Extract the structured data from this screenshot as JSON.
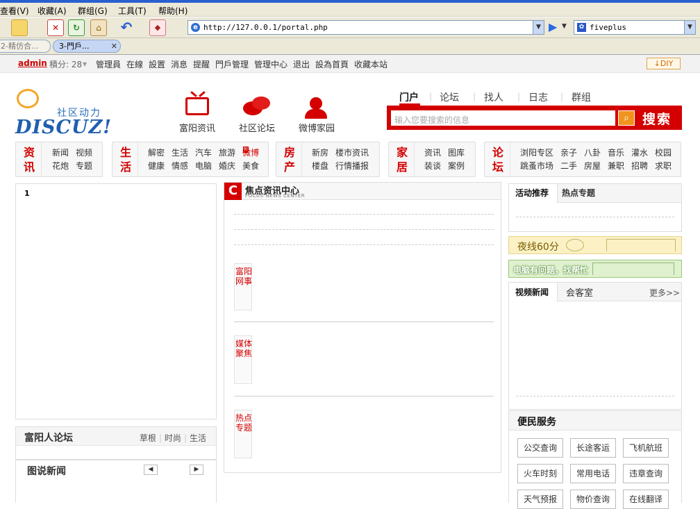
{
  "browser": {
    "menu": [
      "查看(V)",
      "收藏(A)",
      "群组(G)",
      "工具(T)",
      "帮助(H)"
    ],
    "address": "http://127.0.0.1/portal.php",
    "search_engine_value": "fiveplus",
    "tabs": [
      {
        "label": "2-精仿合..."
      },
      {
        "label": "3-門戶..."
      }
    ]
  },
  "topnav": {
    "user": "admin",
    "points_label": "積分: 28",
    "links": [
      "管理員",
      "在線",
      "設置",
      "消息",
      "提醒",
      "門戶管理",
      "管理中心",
      "退出",
      "設為首頁",
      "收藏本站"
    ],
    "diy": "DIY"
  },
  "header": {
    "logo_slogan": "社区动力",
    "logo_brand": "DISCUZ!",
    "nav_icons": [
      {
        "label": "富阳资讯",
        "icon": "tv-icon"
      },
      {
        "label": "社区论坛",
        "icon": "chat-bubbles-icon"
      },
      {
        "label": "微博家园",
        "icon": "person-icon"
      }
    ],
    "search_tabs": [
      "门户",
      "论坛",
      "找人",
      "日志",
      "群组"
    ],
    "search_placeholder": "输入您要搜索的信息",
    "search_button": "搜索"
  },
  "categories": [
    {
      "head": [
        "资",
        "讯"
      ],
      "links": [
        "新闻",
        "视频",
        "花炮",
        "专题"
      ]
    },
    {
      "head": [
        "生",
        "活"
      ],
      "links": [
        "解密",
        "生活",
        "汽车",
        "旅游",
        "微博",
        "健康",
        "情感",
        "电脑",
        "婚庆",
        "美食"
      ],
      "hot": "微博",
      "hot_badge": "N"
    },
    {
      "head": [
        "房",
        "产"
      ],
      "links": [
        "新房",
        "楼市资讯",
        "楼盘",
        "行情播报"
      ]
    },
    {
      "head": [
        "家",
        "居"
      ],
      "links": [
        "资讯",
        "图库",
        "装谈",
        "案例"
      ]
    },
    {
      "head": [
        "论",
        "坛"
      ],
      "links": [
        "浏阳专区",
        "亲子",
        "八卦",
        "音乐",
        "灌水",
        "校园",
        "跳蚤市场",
        "二手",
        "房屋",
        "兼职",
        "招聘",
        "求职"
      ]
    }
  ],
  "left": {
    "box_number": "1",
    "forum_title": "富阳人论坛",
    "forum_links": [
      "草根",
      "时尚",
      "生活"
    ],
    "photo_news_title": "图说新闻"
  },
  "middle": {
    "title": "焦点资讯中心",
    "subtitle": "FOCUS NEWS CENTER",
    "sections": [
      "富阳网事",
      "媒体聚焦",
      "热点专题"
    ]
  },
  "right": {
    "tabs1": [
      "活动推荐",
      "热点专题"
    ],
    "banner1": "夜线60分",
    "banner2": "电脑有问题，找帮忙",
    "tabs2": [
      "视频新闻",
      "会客室"
    ],
    "more": "更多>>",
    "service_title": "便民服务",
    "services": [
      "公交查询",
      "长途客运",
      "飞机航班",
      "火车时刻",
      "常用电话",
      "违章查询",
      "天气预报",
      "物价查询",
      "在线翻译"
    ]
  },
  "colors": {
    "accent": "#d40000",
    "brand_blue": "#1f5fb0"
  }
}
